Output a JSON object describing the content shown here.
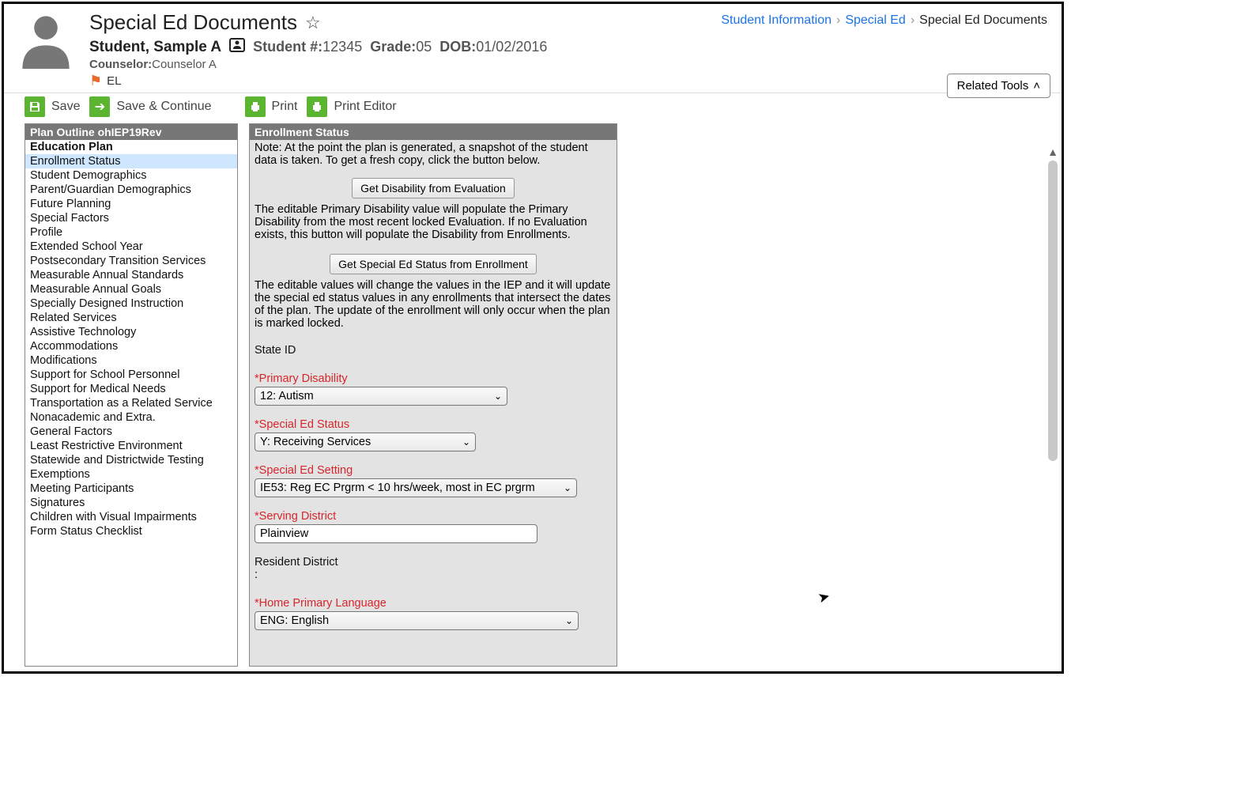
{
  "header": {
    "page_title": "Special Ed Documents",
    "student_name": "Student, Sample A",
    "student_number_label": "Student #:",
    "student_number": "12345",
    "grade_label": "Grade:",
    "grade": "05",
    "dob_label": "DOB:",
    "dob": "01/02/2016",
    "counselor_label": "Counselor:",
    "counselor": "Counselor A",
    "flag_label": "EL"
  },
  "breadcrumb": {
    "item1": "Student Information",
    "item2": "Special Ed",
    "item3": "Special Ed Documents"
  },
  "related_tools_label": "Related Tools",
  "toolbar": {
    "save": "Save",
    "save_continue": "Save & Continue",
    "print": "Print",
    "print_editor": "Print Editor"
  },
  "outline": {
    "header": "Plan Outline ohIEP19Rev",
    "items": [
      "Education Plan",
      "Enrollment Status",
      "Student Demographics",
      "Parent/Guardian Demographics",
      "Future Planning",
      "Special Factors",
      "Profile",
      "Extended School Year",
      "Postsecondary Transition Services",
      "Measurable Annual Standards",
      "Measurable Annual Goals",
      "Specially Designed Instruction",
      "Related Services",
      "Assistive Technology",
      "Accommodations",
      "Modifications",
      "Support for School Personnel",
      "Support for Medical Needs",
      "Transportation as a Related Service",
      "Nonacademic and Extra.",
      "General Factors",
      "Least Restrictive Environment",
      "Statewide and Districtwide Testing",
      "Exemptions",
      "Meeting Participants",
      "Signatures",
      "Children with Visual Impairments",
      "Form Status Checklist"
    ]
  },
  "panel": {
    "header": "Enrollment Status",
    "note": "Note: At the point the plan is generated, a snapshot of the student data is taken. To get a fresh copy, click the button below.",
    "btn_get_disability": "Get Disability from Evaluation",
    "desc_disability": "The editable Primary Disability value will populate the Primary Disability from the most recent locked Evaluation. If no Evaluation exists, this button will populate the Disability from Enrollments.",
    "btn_get_status": "Get Special Ed Status from Enrollment",
    "desc_status": "The editable values will change the values in the IEP and it will update the special ed status values in any enrollments that intersect the dates of the plan. The update of the enrollment will only occur when the plan is marked locked.",
    "state_id_label": "State ID",
    "primary_disability_label": "*Primary Disability",
    "primary_disability_value": "12: Autism",
    "sped_status_label": "*Special Ed Status",
    "sped_status_value": "Y: Receiving Services",
    "sped_setting_label": "*Special Ed Setting",
    "sped_setting_value": "IE53: Reg EC Prgrm < 10 hrs/week, most in EC prgrm",
    "serving_district_label": "*Serving District",
    "serving_district_value": "Plainview",
    "resident_district_label": "Resident District",
    "resident_district_value": ":",
    "home_lang_label": "*Home Primary Language",
    "home_lang_value": "ENG: English"
  }
}
